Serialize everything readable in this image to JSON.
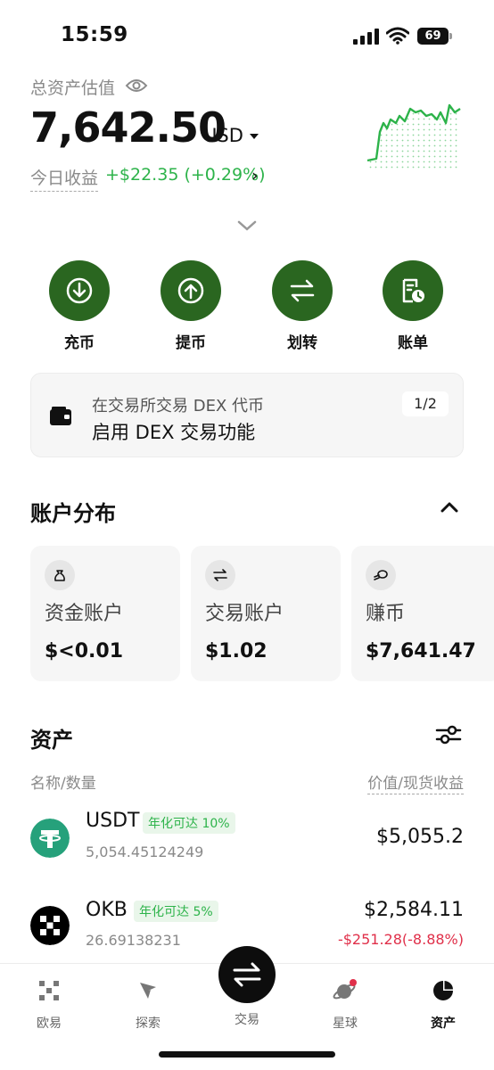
{
  "status": {
    "time": "15:59",
    "battery": "69"
  },
  "header": {
    "total_label": "总资产估值",
    "balance": "7,642.50",
    "currency": "USD",
    "pnl_label": "今日收益",
    "pnl_value": "+$22.35 (+0.29%)"
  },
  "actions": [
    {
      "label": "充币",
      "icon": "deposit-icon"
    },
    {
      "label": "提币",
      "icon": "withdraw-icon"
    },
    {
      "label": "划转",
      "icon": "transfer-icon"
    },
    {
      "label": "账单",
      "icon": "bill-icon"
    }
  ],
  "dex_card": {
    "line1": "在交易所交易 DEX 代币",
    "line2": "启用 DEX 交易功能",
    "pager": "1/2"
  },
  "accounts": {
    "title": "账户分布",
    "items": [
      {
        "label": "资金账户",
        "value": "$<0.01",
        "icon": "money-bag-icon"
      },
      {
        "label": "交易账户",
        "value": "$1.02",
        "icon": "swap-icon"
      },
      {
        "label": "赚币",
        "value": "$7,641.47",
        "icon": "coins-icon"
      }
    ]
  },
  "assets": {
    "title": "资产",
    "col_left": "名称/数量",
    "col_right": "价值/现货收益",
    "rows": [
      {
        "symbol": "USDT",
        "badge": "年化可达 10%",
        "amount": "5,054.45124249",
        "value": "$5,055.2",
        "pnl": ""
      },
      {
        "symbol": "OKB",
        "badge": "年化可达 5%",
        "amount": "26.69138231",
        "value": "$2,584.11",
        "pnl": "-$251.28(-8.88%)"
      }
    ]
  },
  "tabbar": {
    "items": [
      {
        "label": "欧易",
        "icon": "okx-logo-icon"
      },
      {
        "label": "探索",
        "icon": "compass-icon"
      },
      {
        "label": "交易",
        "icon": "trade-swap-icon"
      },
      {
        "label": "星球",
        "icon": "planet-icon"
      },
      {
        "label": "资产",
        "icon": "pie-chart-icon"
      }
    ]
  },
  "colors": {
    "accent_green": "#2a6620",
    "gain": "#2db34a",
    "loss": "#e0304a"
  }
}
